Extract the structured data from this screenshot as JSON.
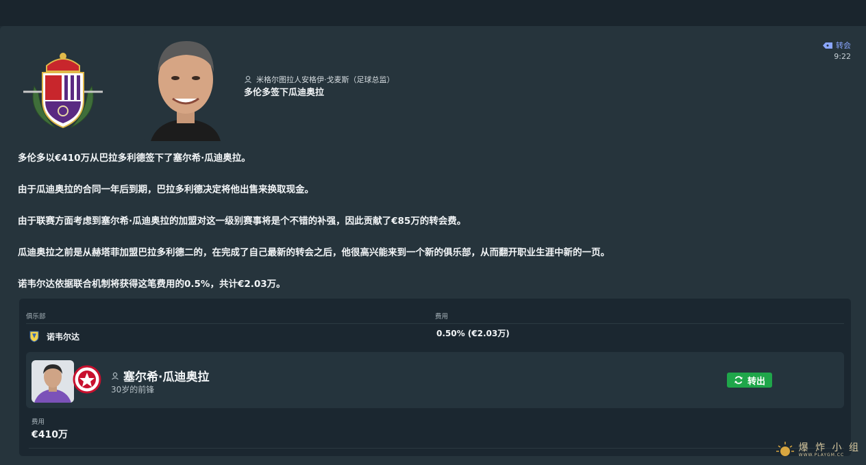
{
  "header": {
    "sender": "米格尔图拉人安格伊·戈麦斯（足球总监）",
    "subject": "多伦多签下瓜迪奥拉",
    "tag": "转会",
    "time": "9:22"
  },
  "body": {
    "paragraphs": [
      "多伦多以€410万从巴拉多利德签下了塞尔希·瓜迪奥拉。",
      "由于瓜迪奥拉的合同一年后到期，巴拉多利德决定将他出售来换取现金。",
      "由于联赛方面考虑到塞尔希·瓜迪奥拉的加盟对这一级别赛事将是个不错的补强，因此贡献了€85万的转会费。",
      "瓜迪奥拉之前是从赫塔菲加盟巴拉多利德二的，在完成了自己最新的转会之后，他很高兴能来到一个新的俱乐部，从而翻开职业生涯中新的一页。",
      "诺韦尔达依据联合机制将获得这笔费用的0.5%，共计€2.03万。"
    ]
  },
  "solidarity_table": {
    "col_club": "俱乐部",
    "col_fee": "费用",
    "row": {
      "club": "诺韦尔达",
      "fee": "0.50% (€2.03万)"
    }
  },
  "player": {
    "name": "塞尔希·瓜迪奥拉",
    "description": "30岁的前锋",
    "transfer_badge": "转出",
    "fee_label": "费用",
    "fee_value": "€410万"
  },
  "watermark": {
    "text": "爆 炸 小 组",
    "url": "WWW.PLAYGM.CC"
  },
  "colors": {
    "badge_green": "#1fa64a",
    "tag_blue": "#8aa6ff",
    "panel_bg": "#26343c",
    "card_bg": "#1b2730"
  }
}
